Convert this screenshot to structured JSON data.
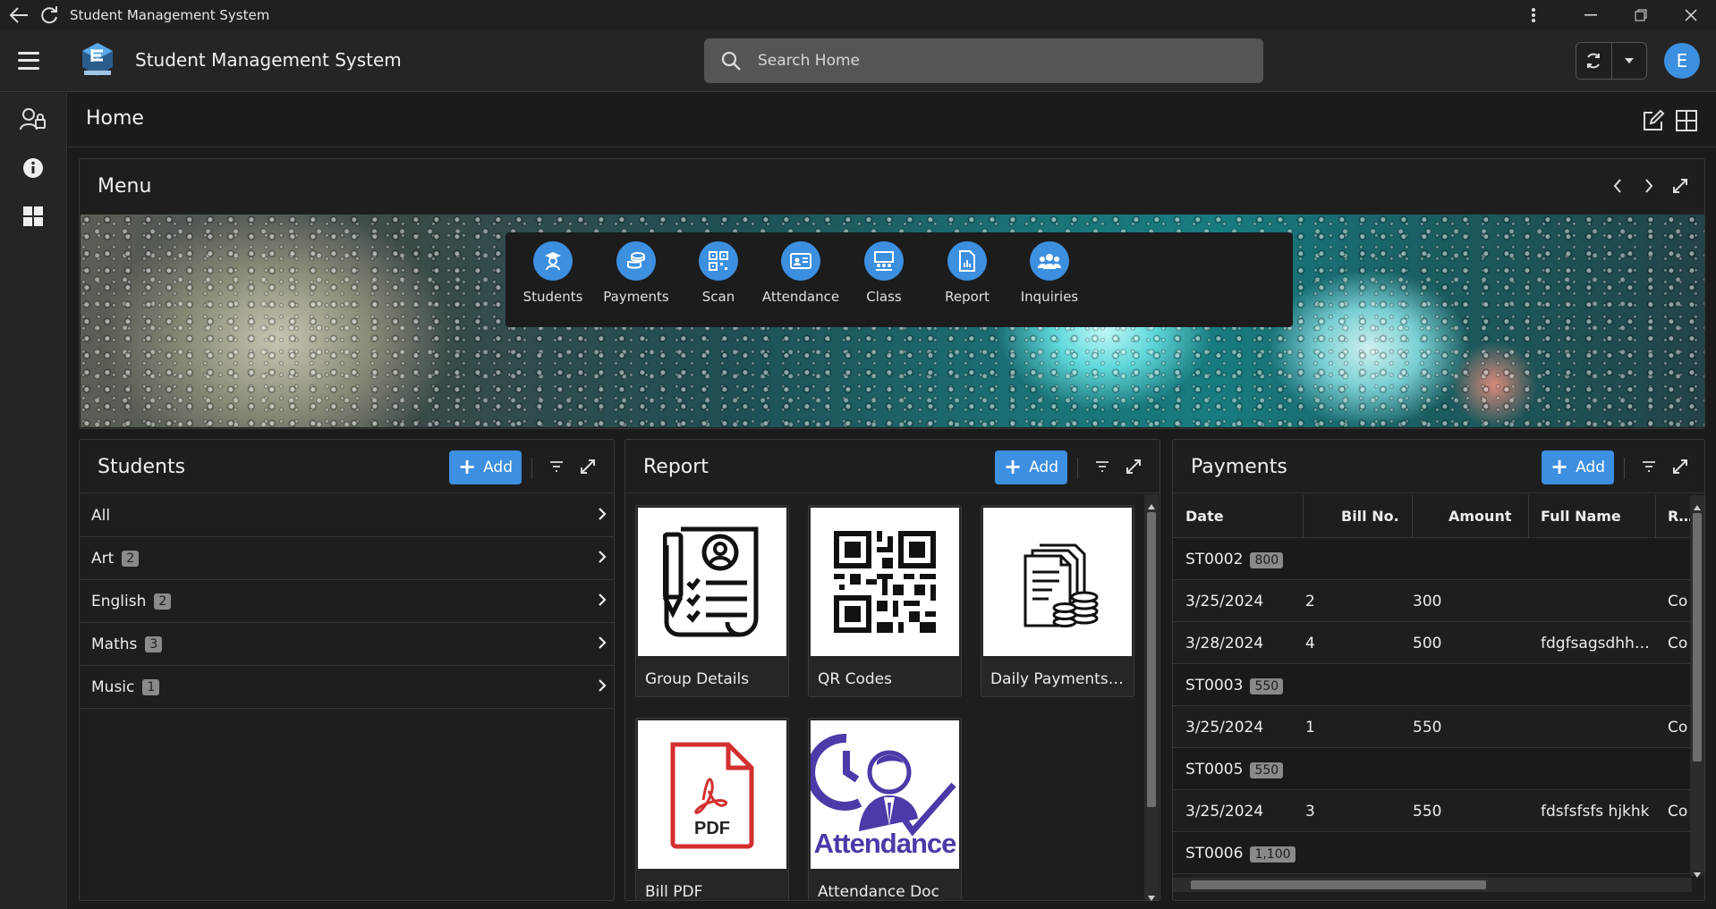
{
  "window": {
    "title": "Student Management System"
  },
  "app": {
    "title": "Student Management System",
    "avatar_initial": "E"
  },
  "search": {
    "placeholder": "Search Home"
  },
  "page": {
    "title": "Home"
  },
  "menu": {
    "title": "Menu",
    "items": [
      {
        "label": "Students",
        "icon": "student-icon"
      },
      {
        "label": "Payments",
        "icon": "coins-icon"
      },
      {
        "label": "Scan",
        "icon": "qr-icon"
      },
      {
        "label": "Attendance",
        "icon": "id-card-icon"
      },
      {
        "label": "Class",
        "icon": "classroom-icon"
      },
      {
        "label": "Report",
        "icon": "report-icon"
      },
      {
        "label": "Inquiries",
        "icon": "people-icon"
      }
    ]
  },
  "students": {
    "title": "Students",
    "add_label": "Add",
    "items": [
      {
        "label": "All",
        "count": ""
      },
      {
        "label": "Art",
        "count": "2"
      },
      {
        "label": "English",
        "count": "2"
      },
      {
        "label": "Maths",
        "count": "3"
      },
      {
        "label": "Music",
        "count": "1"
      }
    ]
  },
  "report": {
    "title": "Report",
    "add_label": "Add",
    "cards": [
      {
        "label": "Group Details",
        "icon": "document-user-icon"
      },
      {
        "label": "QR Codes",
        "icon": "qr-code-icon"
      },
      {
        "label": "Daily Payments ...",
        "icon": "payments-doc-icon"
      },
      {
        "label": "Bill PDF",
        "icon": "pdf-icon"
      },
      {
        "label": "Attendance Doc",
        "icon": "attendance-icon",
        "image_text": "Attendance"
      }
    ],
    "pdf_text": "PDF"
  },
  "payments": {
    "title": "Payments",
    "add_label": "Add",
    "columns": [
      "Date",
      "Bill No.",
      "Amount",
      "Full Name",
      "Rea"
    ],
    "rows": [
      {
        "type": "group",
        "id": "ST0002",
        "total": "800"
      },
      {
        "type": "row",
        "date": "3/25/2024",
        "bill": "2",
        "amount": "300",
        "name": "",
        "reason": "Co"
      },
      {
        "type": "row",
        "date": "3/28/2024",
        "bill": "4",
        "amount": "500",
        "name": "fdgfsagsdhhjn...",
        "reason": "Co"
      },
      {
        "type": "group",
        "id": "ST0003",
        "total": "550"
      },
      {
        "type": "row",
        "date": "3/25/2024",
        "bill": "1",
        "amount": "550",
        "name": "",
        "reason": "Co"
      },
      {
        "type": "group",
        "id": "ST0005",
        "total": "550"
      },
      {
        "type": "row",
        "date": "3/25/2024",
        "bill": "3",
        "amount": "550",
        "name": "fdsfsfsfs hjkhk",
        "reason": "Co"
      },
      {
        "type": "group",
        "id": "ST0006",
        "total": "1,100"
      }
    ]
  },
  "colors": {
    "accent": "#3d8fe0",
    "background": "#1b1b1b",
    "panel": "#1e1e1e"
  }
}
